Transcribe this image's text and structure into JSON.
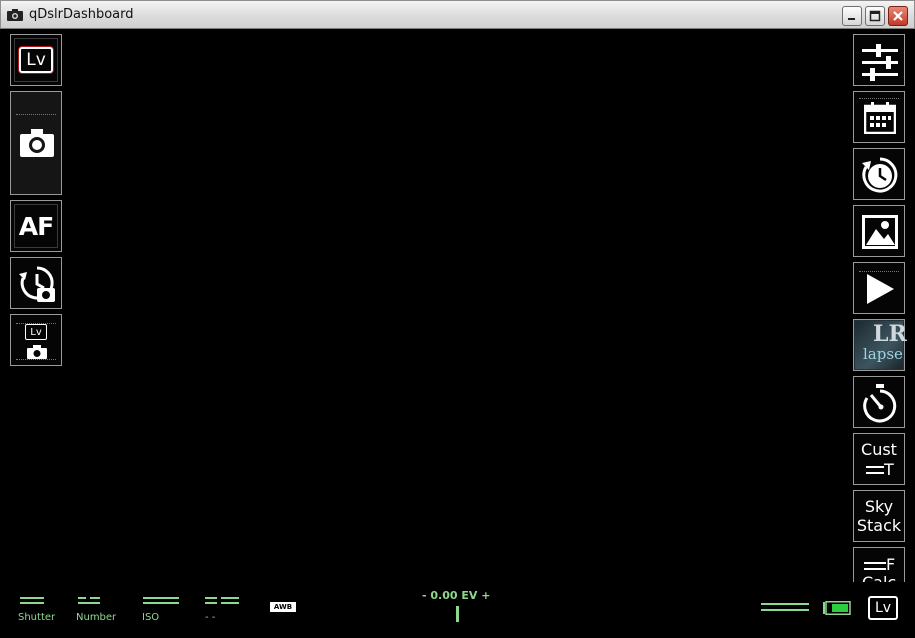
{
  "window": {
    "title": "qDslrDashboard",
    "icons": {
      "app": "camera-icon",
      "minimize": "minimize-icon",
      "maximize": "maximize-icon",
      "close": "close-icon"
    }
  },
  "left_toolbar": {
    "items": [
      {
        "name": "live-view-button",
        "icon": "live-view-icon",
        "label": "Lv"
      },
      {
        "name": "capture-button",
        "icon": "camera-icon"
      },
      {
        "name": "autofocus-button",
        "icon": "autofocus-icon",
        "label": "AF"
      },
      {
        "name": "timer-capture-button",
        "icon": "timer-camera-icon"
      },
      {
        "name": "liveview-capture-button",
        "icon": "liveview-camera-icon",
        "label": "Lv"
      }
    ]
  },
  "right_toolbar": {
    "items": [
      {
        "name": "settings-sliders-button",
        "icon": "sliders-icon"
      },
      {
        "name": "schedule-button",
        "icon": "calendar-icon"
      },
      {
        "name": "history-button",
        "icon": "clock-history-icon"
      },
      {
        "name": "gallery-button",
        "icon": "image-icon"
      },
      {
        "name": "play-button",
        "icon": "play-icon"
      },
      {
        "name": "lrtimelapse-button",
        "icon": "lrtimelapse-icon",
        "label_top": "LR",
        "label_bottom": "lapse"
      },
      {
        "name": "self-timer-button",
        "icon": "stopwatch-icon"
      },
      {
        "name": "custom-bracket-button",
        "label": "Cust",
        "sub_label": "T"
      },
      {
        "name": "sky-stack-button",
        "label_line1": "Sky",
        "label_line2": "Stack"
      },
      {
        "name": "focus-calc-button",
        "label_line1": "F",
        "label_line2": "Calc"
      }
    ]
  },
  "bottom_bar": {
    "shutter": {
      "label": "Shutter"
    },
    "aperture": {
      "label": "Number"
    },
    "iso": {
      "label": "ISO"
    },
    "wb_mode": {
      "label": "- -"
    },
    "white_balance": {
      "label": "AWB"
    },
    "exposure": {
      "value": "- 0.00 EV +"
    },
    "battery": {
      "icon": "battery-icon"
    },
    "liveview_toggle": {
      "icon": "live-view-icon",
      "label": "Lv"
    }
  },
  "colors": {
    "background": "#000000",
    "accent_green": "#8ed88e",
    "battery_green": "#2ecc40",
    "button_border": "#9a9a9a",
    "lv_red": "#b01414"
  }
}
